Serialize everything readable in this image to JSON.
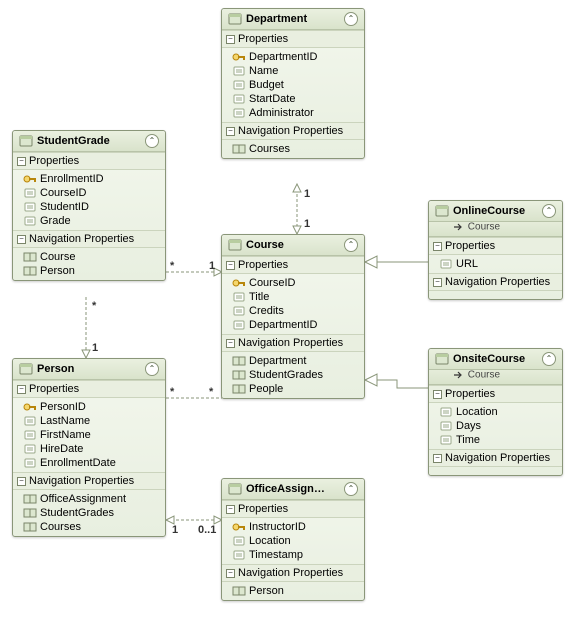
{
  "sections": {
    "properties": "Properties",
    "navprops": "Navigation Properties"
  },
  "entities": {
    "department": {
      "title": "Department",
      "props": [
        {
          "name": "DepartmentID",
          "key": true
        },
        {
          "name": "Name",
          "key": false
        },
        {
          "name": "Budget",
          "key": false
        },
        {
          "name": "StartDate",
          "key": false
        },
        {
          "name": "Administrator",
          "key": false
        }
      ],
      "navs": [
        {
          "name": "Courses"
        }
      ]
    },
    "studentgrade": {
      "title": "StudentGrade",
      "props": [
        {
          "name": "EnrollmentID",
          "key": true
        },
        {
          "name": "CourseID",
          "key": false
        },
        {
          "name": "StudentID",
          "key": false
        },
        {
          "name": "Grade",
          "key": false
        }
      ],
      "navs": [
        {
          "name": "Course"
        },
        {
          "name": "Person"
        }
      ]
    },
    "person": {
      "title": "Person",
      "props": [
        {
          "name": "PersonID",
          "key": true
        },
        {
          "name": "LastName",
          "key": false
        },
        {
          "name": "FirstName",
          "key": false
        },
        {
          "name": "HireDate",
          "key": false
        },
        {
          "name": "EnrollmentDate",
          "key": false
        }
      ],
      "navs": [
        {
          "name": "OfficeAssignment"
        },
        {
          "name": "StudentGrades"
        },
        {
          "name": "Courses"
        }
      ]
    },
    "course": {
      "title": "Course",
      "props": [
        {
          "name": "CourseID",
          "key": true
        },
        {
          "name": "Title",
          "key": false
        },
        {
          "name": "Credits",
          "key": false
        },
        {
          "name": "DepartmentID",
          "key": false
        }
      ],
      "navs": [
        {
          "name": "Department"
        },
        {
          "name": "StudentGrades"
        },
        {
          "name": "People"
        }
      ]
    },
    "officeassignment": {
      "title": "OfficeAssign…",
      "props": [
        {
          "name": "InstructorID",
          "key": true
        },
        {
          "name": "Location",
          "key": false
        },
        {
          "name": "Timestamp",
          "key": false
        }
      ],
      "navs": [
        {
          "name": "Person"
        }
      ]
    },
    "onlinecourse": {
      "title": "OnlineCourse",
      "subtitle": "Course",
      "props": [
        {
          "name": "URL",
          "key": false
        }
      ],
      "navs": []
    },
    "onsitecourse": {
      "title": "OnsiteCourse",
      "subtitle": "Course",
      "props": [
        {
          "name": "Location",
          "key": false
        },
        {
          "name": "Days",
          "key": false
        },
        {
          "name": "Time",
          "key": false
        }
      ],
      "navs": []
    }
  },
  "multiplicities": {
    "dept_course_top": "1",
    "dept_course_bottom": "1",
    "sg_course_left": "*",
    "sg_course_right": "1",
    "sg_person_top": "*",
    "sg_person_bottom": "1",
    "person_course_left": "*",
    "person_course_right": "*",
    "person_office_left": "1",
    "person_office_right": "0..1"
  }
}
